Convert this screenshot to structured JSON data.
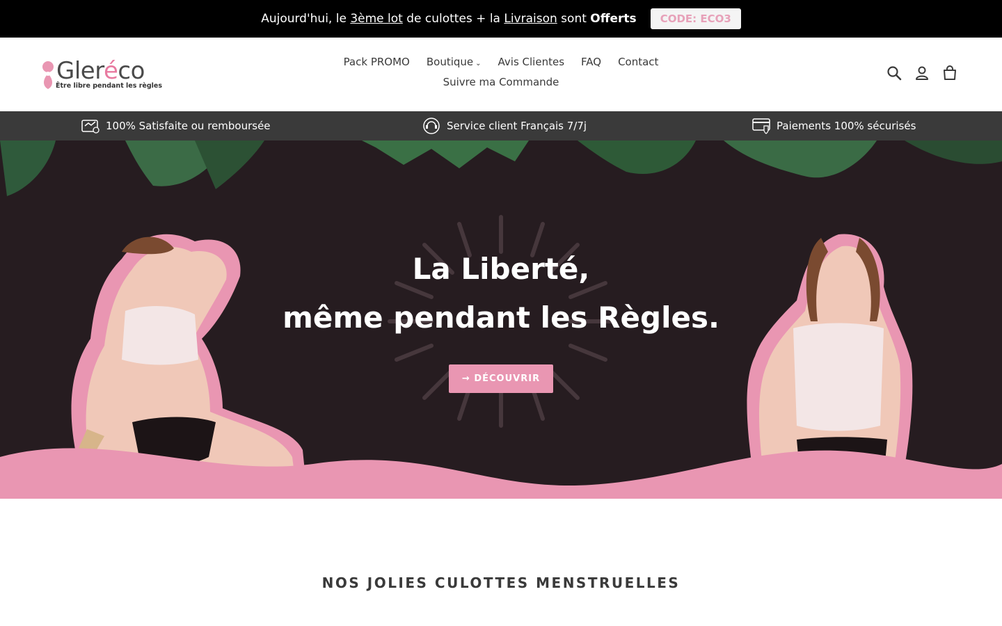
{
  "announcement": {
    "part1": "Aujourd'hui, le ",
    "link1": "3ème lot",
    "part2": " de culottes + la ",
    "link2": "Livraison",
    "part3": " sont ",
    "bold": "Offerts",
    "code": "CODE: ECO3"
  },
  "brand": {
    "name_prefix": "Gler",
    "name_accent": "é",
    "name_suffix": "co",
    "tagline": "Être libre pendant les règles",
    "accent_color": "#e996b2"
  },
  "nav": {
    "items": [
      "Pack PROMO",
      "Boutique",
      "Avis Clientes",
      "FAQ",
      "Contact"
    ],
    "caret": "⌄",
    "second_row": "Suivre ma Commande"
  },
  "header_icons": [
    "search-icon",
    "account-icon",
    "cart-icon"
  ],
  "trust": {
    "items": [
      {
        "icon": "refund-icon",
        "label": "100% Satisfaite ou remboursée"
      },
      {
        "icon": "support-icon",
        "label": "Service client Français 7/7j"
      },
      {
        "icon": "secure-payment-icon",
        "label": "Paiements 100% sécurisés"
      }
    ]
  },
  "hero": {
    "title_line1": "La Liberté,",
    "title_line2": "même pendant les Règles.",
    "cta": "→ DÉCOUVRIR"
  },
  "section": {
    "title": "NOS JOLIES CULOTTES MENSTRUELLES"
  }
}
